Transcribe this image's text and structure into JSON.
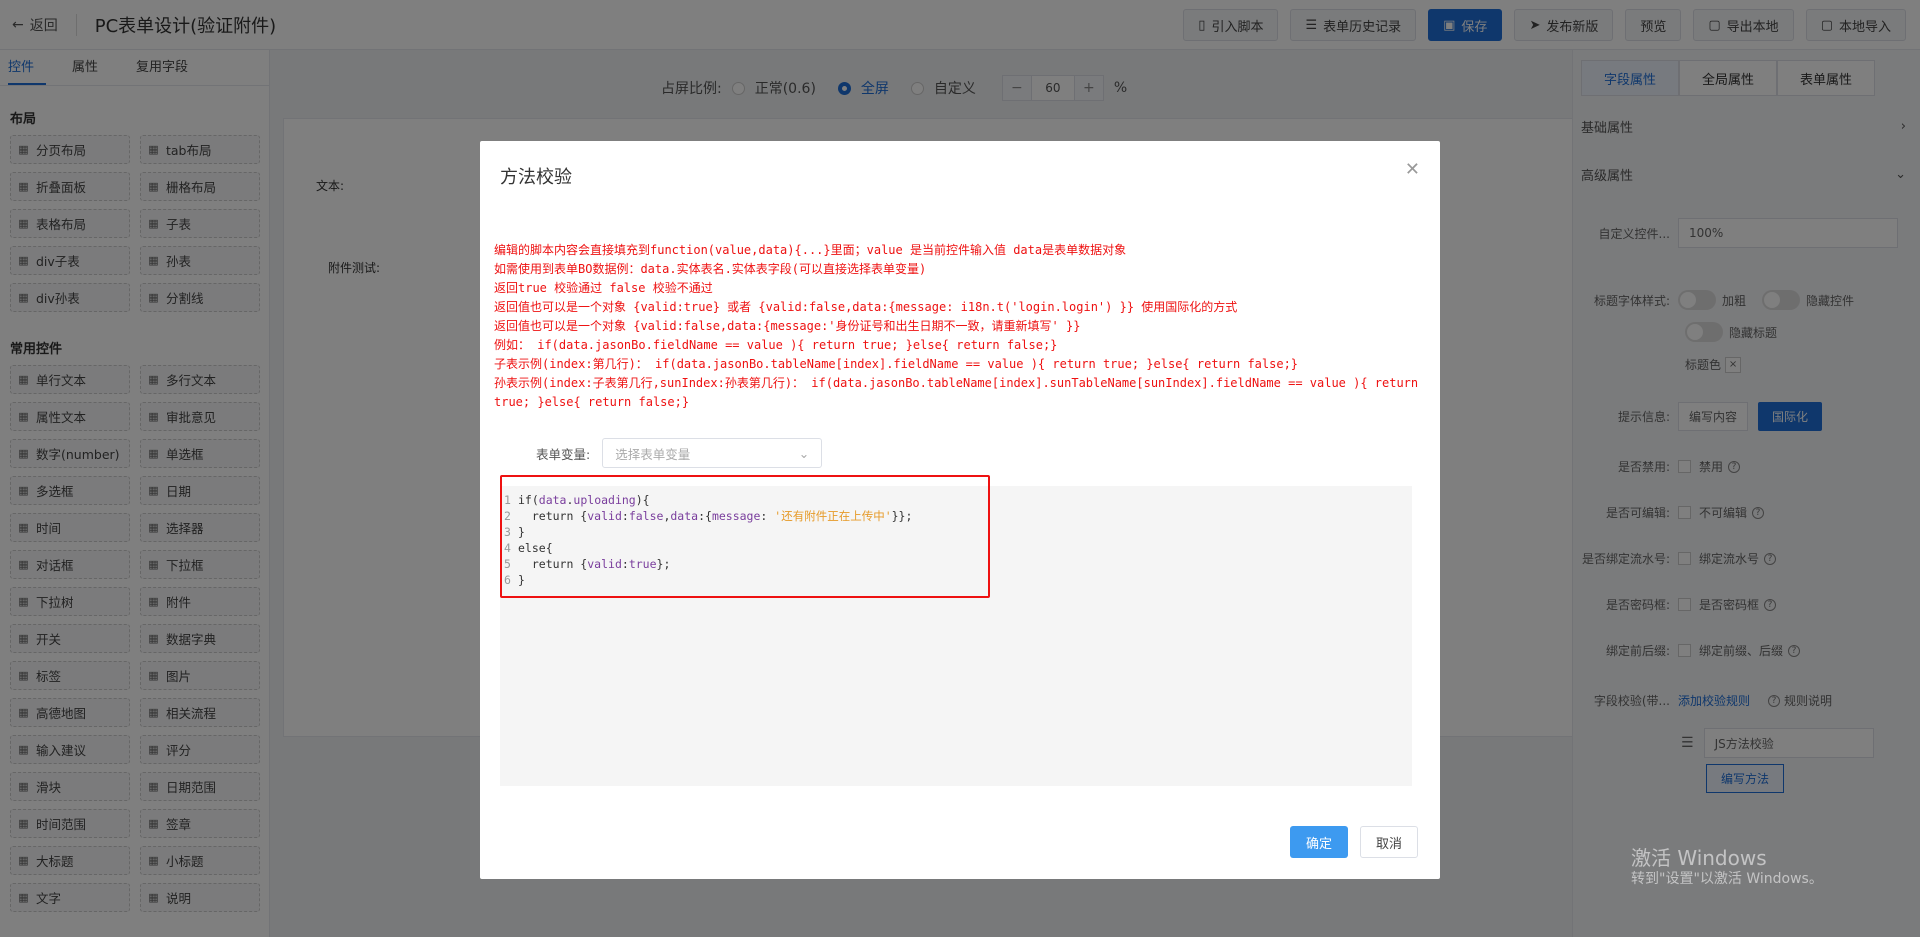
{
  "header": {
    "back": "返回",
    "title": "PC表单设计(验证附件)",
    "buttons": [
      "引入脚本",
      "表单历史记录",
      "保存",
      "发布新版",
      "预览",
      "导出本地",
      "本地导入"
    ]
  },
  "left": {
    "tabs": [
      "控件",
      "属性",
      "复用字段"
    ],
    "layout_title": "布局",
    "layout": [
      "分页布局",
      "tab布局",
      "折叠面板",
      "栅格布局",
      "表格布局",
      "子表",
      "div子表",
      "孙表",
      "div孙表",
      "分割线"
    ],
    "common_title": "常用控件",
    "common": [
      "单行文本",
      "多行文本",
      "属性文本",
      "审批意见",
      "数字(number)",
      "单选框",
      "多选框",
      "日期",
      "时间",
      "选择器",
      "对话框",
      "下拉框",
      "下拉树",
      "附件",
      "开关",
      "数据字典",
      "标签",
      "图片",
      "高德地图",
      "相关流程",
      "输入建议",
      "评分",
      "滑块",
      "日期范围",
      "时间范围",
      "签章",
      "大标题",
      "小标题",
      "文字",
      "说明"
    ]
  },
  "center": {
    "ratio_label": "占屏比例:",
    "normal": "正常(0.6)",
    "full": "全屏",
    "custom": "自定义",
    "minus": "−",
    "zoom": "60",
    "plus": "+",
    "percent": "%",
    "field_text": "文本:",
    "field_attach": "附件测试:"
  },
  "right": {
    "tabs": [
      "字段属性",
      "全局属性",
      "表单属性"
    ],
    "basic": "基础属性",
    "advanced": "高级属性",
    "custom_ctrl": "自定义控件...",
    "custom_val": "100%",
    "title_style": "标题字体样式:",
    "bold": "加粗",
    "hide_ctrl": "隐藏控件",
    "hide_title": "隐藏标题",
    "title_color": "标题色",
    "hint": "提示信息:",
    "edit_content": "编写内容",
    "i18n": "国际化",
    "disabled_q": "是否禁用:",
    "disabled": "禁用",
    "editable_q": "是否可编辑:",
    "not_edit": "不可编辑",
    "serial_q": "是否绑定流水号:",
    "serial": "绑定流水号",
    "pwd_q": "是否密码框:",
    "pwd": "是否密码框",
    "fix_q": "绑定前后缀:",
    "fix": "绑定前缀、后缀",
    "verify_q": "字段校验(带...",
    "add_rule": "添加校验规则",
    "rule_help": "规则说明",
    "rule_sel": "JS方法校验",
    "write_method": "编写方法"
  },
  "dialog": {
    "title": "方法校验",
    "tips": [
      "编辑的脚本内容会直接填充到function(value,data){...}里面；value 是当前控件输入值 data是表单数据对象",
      "如需使用到表单BO数据例：data.实体表名.实体表字段(可以直接选择表单变量)",
      "返回true 校验通过 false 校验不通过",
      "返回值也可以是一个对象 {valid:true} 或者 {valid:false,data:{message: i18n.t('login.login') }} 使用国际化的方式",
      "返回值也可以是一个对象 {valid:false,data:{message:'身份证号和出生日期不一致，请重新填写' }}",
      "例如： if(data.jasonBo.fieldName == value ){ return true; }else{ return false;}",
      "子表示例(index:第几行)： if(data.jasonBo.tableName[index].fieldName == value ){ return true; }else{ return false;}",
      "孙表示例(index:子表第几行,sunIndex:孙表第几行)： if(data.jasonBo.tableName[index].sunTableName[sunIndex].fieldName == value ){ return true; }else{ return false;}"
    ],
    "var_label": "表单变量:",
    "var_placeholder": "选择表单变量",
    "code_msg": "'还有附件正在上传中'",
    "ok": "确定",
    "cancel": "取消"
  },
  "watermark": {
    "line1": "激活 Windows",
    "line2": "转到\"设置\"以激活 Windows。"
  }
}
